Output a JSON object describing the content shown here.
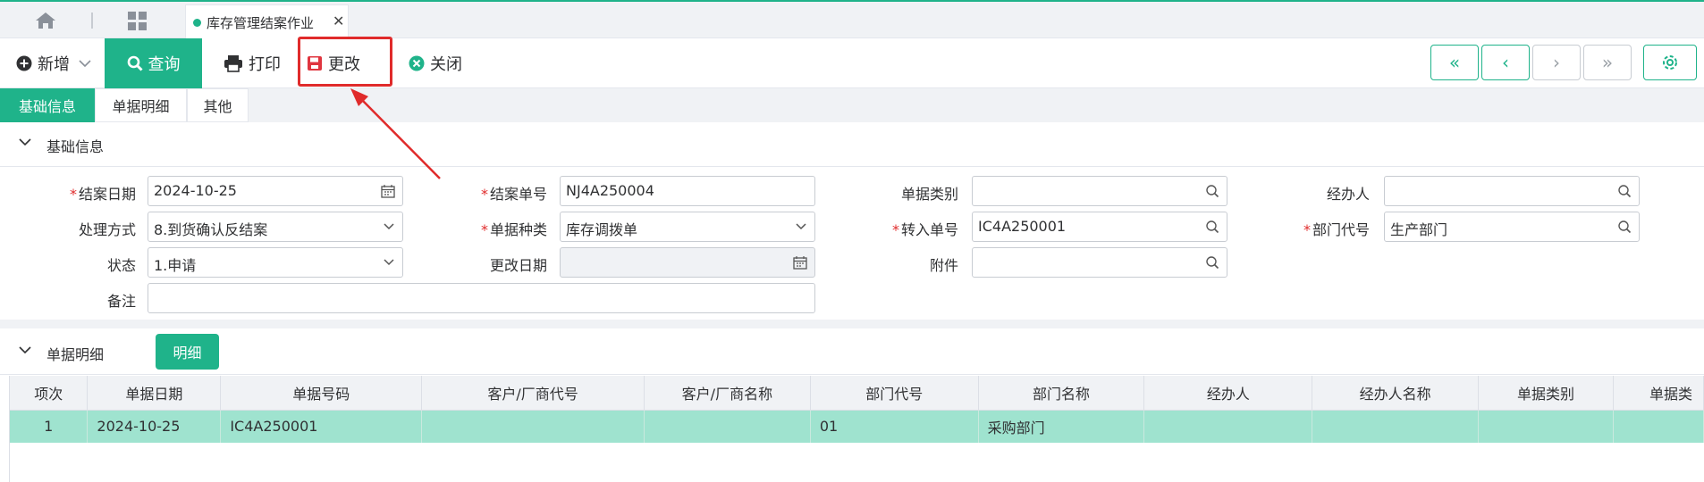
{
  "tabs": {
    "active_label": "库存管理结案作业"
  },
  "toolbar": {
    "new_label": "新增",
    "query_label": "查询",
    "print_label": "打印",
    "edit_label": "更改",
    "close_label": "关闭",
    "nav": [
      "«",
      "‹",
      "›",
      "»"
    ]
  },
  "subtabs": [
    "基础信息",
    "单据明细",
    "其他"
  ],
  "basic": {
    "title": "基础信息",
    "fields": {
      "close_date": {
        "label": "结案日期",
        "value": "2024-10-25"
      },
      "close_no": {
        "label": "结案单号",
        "value": "NJ4A250004"
      },
      "doc_type": {
        "label": "单据类别",
        "value": ""
      },
      "handler": {
        "label": "经办人",
        "value": ""
      },
      "method": {
        "label": "处理方式",
        "value": "8.到货确认反结案"
      },
      "doc_kind": {
        "label": "单据种类",
        "value": "库存调拨单"
      },
      "in_no": {
        "label": "转入单号",
        "value": "IC4A250001"
      },
      "dept_code": {
        "label": "部门代号",
        "value": "生产部门"
      },
      "status": {
        "label": "状态",
        "value": "1.申请"
      },
      "change_date": {
        "label": "更改日期",
        "value": ""
      },
      "attachment": {
        "label": "附件",
        "value": ""
      },
      "remark": {
        "label": "备注",
        "value": ""
      }
    }
  },
  "detail": {
    "title": "单据明细",
    "button_label": "明细",
    "columns": [
      "项次",
      "单据日期",
      "单据号码",
      "客户/厂商代号",
      "客户/厂商名称",
      "部门代号",
      "部门名称",
      "经办人",
      "经办人名称",
      "单据类别",
      "单据类"
    ],
    "rows": [
      [
        "1",
        "2024-10-25",
        "IC4A250001",
        "",
        "",
        "01",
        "采购部门",
        "",
        "",
        "",
        ""
      ]
    ]
  },
  "colors": {
    "accent": "#1fb38a",
    "highlight": "#e02b2b",
    "row_selected": "#9fe3cf"
  }
}
